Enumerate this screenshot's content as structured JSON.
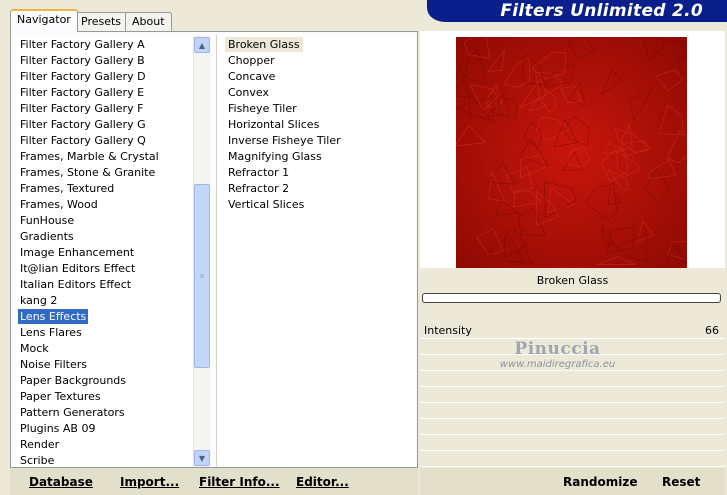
{
  "tabs": [
    {
      "label": "Navigator",
      "active": true
    },
    {
      "label": "Presets",
      "active": false
    },
    {
      "label": "About",
      "active": false
    }
  ],
  "banner": {
    "title": "Filters Unlimited 2.0"
  },
  "categories": {
    "items": [
      "Filter Factory Gallery A",
      "Filter Factory Gallery B",
      "Filter Factory Gallery D",
      "Filter Factory Gallery E",
      "Filter Factory Gallery F",
      "Filter Factory Gallery G",
      "Filter Factory Gallery Q",
      "Frames, Marble & Crystal",
      "Frames, Stone & Granite",
      "Frames, Textured",
      "Frames, Wood",
      "FunHouse",
      "Gradients",
      "Image Enhancement",
      "It@lian Editors Effect",
      "Italian Editors Effect",
      "kang 2",
      "Lens Effects",
      "Lens Flares",
      "Mock",
      "Noise Filters",
      "Paper Backgrounds",
      "Paper Textures",
      "Pattern Generators",
      "Plugins AB 09",
      "Render",
      "Scribe"
    ],
    "selected": "Lens Effects"
  },
  "filters": {
    "items": [
      "Broken Glass",
      "Chopper",
      "Concave",
      "Convex",
      "Fisheye Tiler",
      "Horizontal Slices",
      "Inverse Fisheye Tiler",
      "Magnifying Glass",
      "Refractor 1",
      "Refractor 2",
      "Vertical Slices"
    ],
    "selected": "Broken Glass"
  },
  "preview": {
    "filter_name": "Broken Glass",
    "base_color": "#b10f06"
  },
  "params": [
    {
      "label": "Intensity",
      "value": "66"
    }
  ],
  "watermark": {
    "name": "Pinuccia",
    "url": "www.maidiregrafica.eu"
  },
  "buttons": {
    "database": "Database",
    "import": "Import...",
    "filter_info": "Filter Info...",
    "editor": "Editor...",
    "randomize": "Randomize",
    "reset": "Reset"
  },
  "icons": {
    "scroll_up": "chevron-up-icon",
    "scroll_down": "chevron-down-icon",
    "scroll_grip": "grip-icon"
  }
}
